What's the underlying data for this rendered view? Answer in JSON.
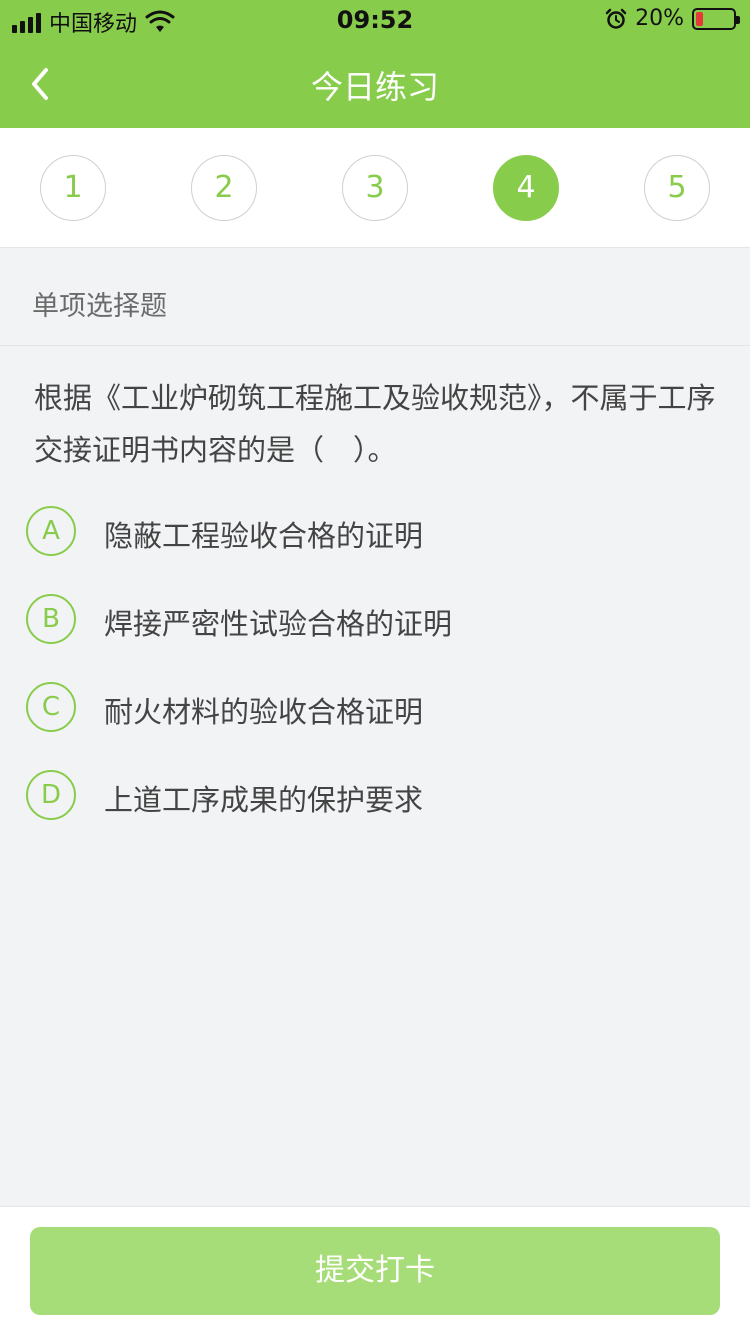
{
  "status_bar": {
    "carrier": "中国移动",
    "time": "09:52",
    "battery_percent": "20%",
    "battery_level": 0.2,
    "icons": [
      "signal-icon",
      "wifi-icon",
      "alarm-icon",
      "battery-icon"
    ]
  },
  "nav": {
    "title": "今日练习",
    "back_icon": "chevron-left-icon"
  },
  "question_tabs": {
    "items": [
      "1",
      "2",
      "3",
      "4",
      "5"
    ],
    "active_index": 3
  },
  "section": {
    "type_label": "单项选择题"
  },
  "question": {
    "text": "根据《工业炉砌筑工程施工及验收规范》，不属于工序交接证明书内容的是（　）。"
  },
  "options": [
    {
      "letter": "A",
      "text": "隐蔽工程验收合格的证明"
    },
    {
      "letter": "B",
      "text": "焊接严密性试验合格的证明"
    },
    {
      "letter": "C",
      "text": "耐火材料的验收合格证明"
    },
    {
      "letter": "D",
      "text": "上道工序成果的保护要求"
    }
  ],
  "submit": {
    "label": "提交打卡"
  },
  "colors": {
    "accent": "#88cc4c",
    "submit_bg": "#a7dd78",
    "battery_low": "#e53935"
  }
}
